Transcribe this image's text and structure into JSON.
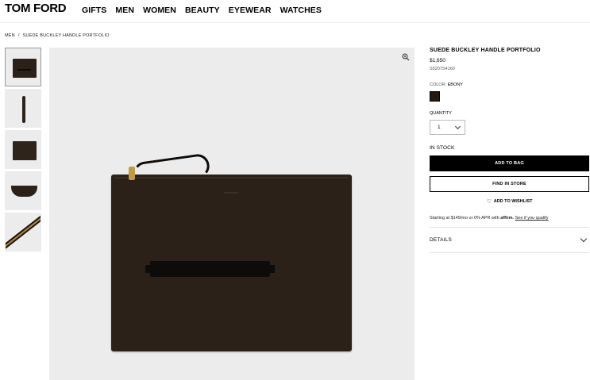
{
  "header": {
    "logo": "TOM FORD",
    "nav": [
      "GIFTS",
      "MEN",
      "WOMEN",
      "BEAUTY",
      "EYEWEAR",
      "WATCHES"
    ]
  },
  "breadcrumb": [
    "MEN",
    "/",
    "SUEDE BUCKLEY HANDLE PORTFOLIO"
  ],
  "product": {
    "title": "SUEDE BUCKLEY HANDLE PORTFOLIO",
    "price": "$1,650",
    "sku": "S5207S4160",
    "color_label": "COLOR:",
    "color_value": "EBONY",
    "swatch_color": "#24190f",
    "quantity_label": "QUANTITY",
    "quantity_value": "1",
    "stock": "IN STOCK",
    "add_to_bag": "ADD TO BAG",
    "find_in_store": "FIND IN STORE",
    "add_to_wishlist": "ADD TO WISHLIST",
    "financing_prefix": "Starting at $149/mo or 0% APR with",
    "financing_brand": "affirm.",
    "financing_link": "See if you qualify",
    "details": "DETAILS"
  },
  "icons": {
    "zoom": "zoom-in-icon",
    "heart": "heart-icon",
    "chevron": "chevron-down-icon"
  }
}
